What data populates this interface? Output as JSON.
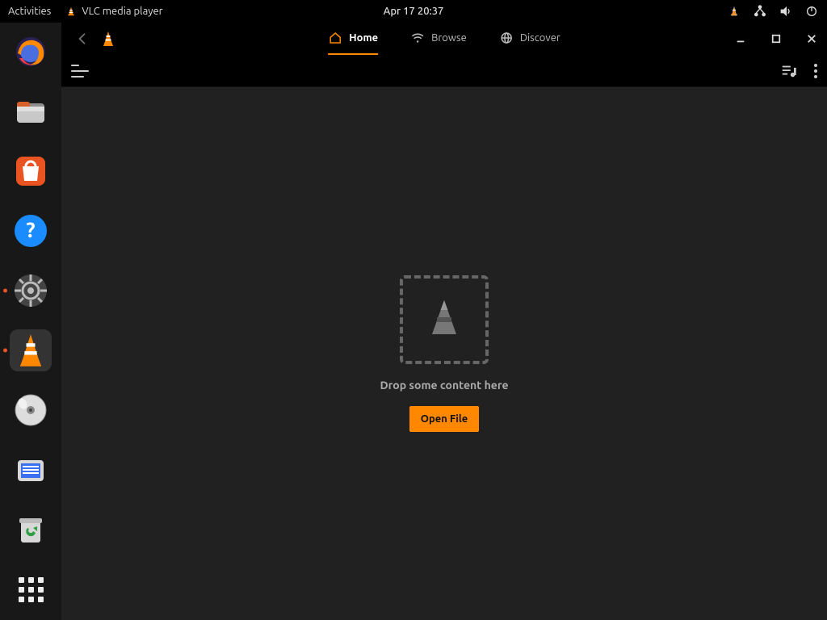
{
  "topbar": {
    "activities": "Activities",
    "app_name": "VLC media player",
    "clock": "Apr 17  20:37"
  },
  "dock": {
    "items": [
      {
        "name": "firefox"
      },
      {
        "name": "files"
      },
      {
        "name": "software"
      },
      {
        "name": "help"
      },
      {
        "name": "settings",
        "running": true
      },
      {
        "name": "vlc",
        "running": true,
        "active": true
      },
      {
        "name": "disk"
      },
      {
        "name": "scanner"
      },
      {
        "name": "trash"
      }
    ]
  },
  "window": {
    "tabs": {
      "home": "Home",
      "browse": "Browse",
      "discover": "Discover"
    },
    "drop_label": "Drop some content here",
    "open_button": "Open File"
  }
}
